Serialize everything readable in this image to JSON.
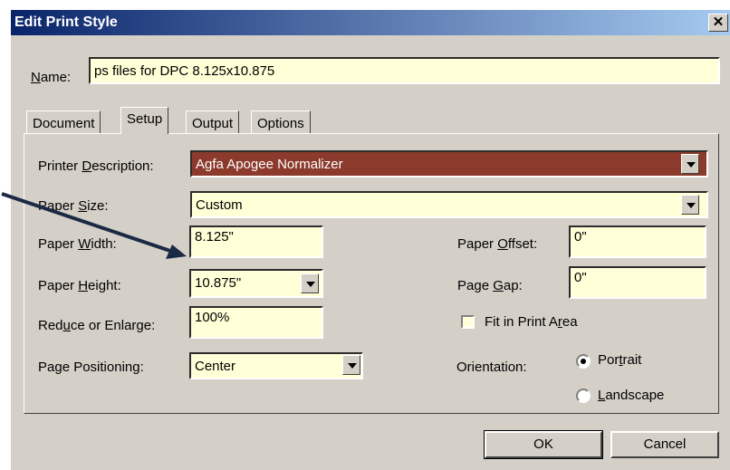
{
  "window": {
    "title": "Edit Print Style",
    "close_glyph": "✕"
  },
  "name": {
    "label_key": "N",
    "label_rest": "ame:",
    "value": "ps files for DPC 8.125x10.875"
  },
  "tabs": [
    {
      "label": "Document"
    },
    {
      "label": "Setup",
      "active": true
    },
    {
      "label": "Output"
    },
    {
      "label": "Options"
    }
  ],
  "setup": {
    "printer_description": {
      "label_pre": "Printer ",
      "label_key": "D",
      "label_post": "escription:",
      "value": "Agfa Apogee Normalizer"
    },
    "paper_size": {
      "label_pre": "Paper ",
      "label_key": "S",
      "label_post": "ize:",
      "value": "Custom"
    },
    "paper_width": {
      "label_pre": "Paper ",
      "label_key": "W",
      "label_post": "idth:",
      "value": "8.125\""
    },
    "paper_height": {
      "label_pre": "Paper ",
      "label_key": "H",
      "label_post": "eight:",
      "value": "10.875\""
    },
    "reduce_enlarge": {
      "label_pre": "Red",
      "label_key": "u",
      "label_post": "ce or Enlarge:",
      "value": "100%"
    },
    "page_positioning": {
      "label_pre": "Pa",
      "label_key": "g",
      "label_post": "e Positioning:",
      "value": "Center"
    },
    "paper_offset": {
      "label_pre": "Paper ",
      "label_key": "O",
      "label_post": "ffset:",
      "value": "0\""
    },
    "page_gap": {
      "label_pre": "Page ",
      "label_key": "G",
      "label_post": "ap:",
      "value": "0\""
    },
    "fit_in_print_area": {
      "label_pre": "Fit in Print A",
      "label_key": "r",
      "label_post": "ea",
      "checked": false
    },
    "orientation": {
      "label": "Orientation:",
      "portrait": {
        "label_pre": "Por",
        "label_key": "t",
        "label_post": "rait",
        "selected": true
      },
      "landscape": {
        "label_pre": "",
        "label_key": "L",
        "label_post": "andscape",
        "selected": false
      }
    }
  },
  "buttons": {
    "ok": "OK",
    "cancel": "Cancel"
  },
  "colors": {
    "field_bg": "#ffffd8",
    "selected_bg": "#8b3a2c",
    "title_start": "#0a246a",
    "annotation_arrow": "#1a2a44"
  }
}
